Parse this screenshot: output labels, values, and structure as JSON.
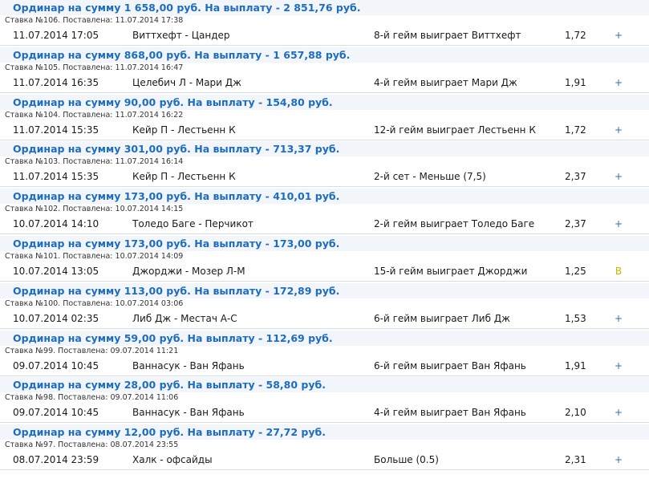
{
  "bets": [
    {
      "title": "Ординар на сумму 1 658,00 руб.  На выплату - 2 851,76 руб.",
      "meta": "Ставка №106. Поставлена: 11.07.2014 17:38",
      "datetime": "11.07.2014 17:05",
      "match": "Виттхефт - Цандер",
      "event": "8-й гейм выиграет Виттхефт",
      "odds": "1,72",
      "result": "+"
    },
    {
      "title": "Ординар на сумму 868,00 руб.  На выплату - 1 657,88 руб.",
      "meta": "Ставка №105. Поставлена: 11.07.2014 16:47",
      "datetime": "11.07.2014 16:35",
      "match": "Целебич Л - Мари Дж",
      "event": "4-й гейм выиграет Мари Дж",
      "odds": "1,91",
      "result": "+"
    },
    {
      "title": "Ординар на сумму 90,00 руб.  На выплату - 154,80 руб.",
      "meta": "Ставка №104. Поставлена: 11.07.2014 16:22",
      "datetime": "11.07.2014 15:35",
      "match": "Кейр П - Лестьенн К",
      "event": "12-й гейм выиграет Лестьенн К",
      "odds": "1,72",
      "result": "+"
    },
    {
      "title": "Ординар на сумму 301,00 руб.  На выплату - 713,37 руб.",
      "meta": "Ставка №103. Поставлена: 11.07.2014 16:14",
      "datetime": "11.07.2014 15:35",
      "match": "Кейр П - Лестьенн К",
      "event": "2-й сет - Меньше (7,5)",
      "odds": "2,37",
      "result": "+"
    },
    {
      "title": "Ординар на сумму 173,00 руб.  На выплату - 410,01 руб.",
      "meta": "Ставка №102. Поставлена: 10.07.2014 14:15",
      "datetime": "10.07.2014 14:10",
      "match": "Толедо Баге - Перчикот",
      "event": "2-й гейм выиграет Толедо Баге",
      "odds": "2,37",
      "result": "+"
    },
    {
      "title": "Ординар на сумму 173,00 руб.  На выплату - 173,00 руб.",
      "meta": "Ставка №101. Поставлена: 10.07.2014 14:09",
      "datetime": "10.07.2014 13:05",
      "match": "Джорджи - Мозер Л-М",
      "event": "15-й гейм выиграет Джорджи",
      "odds": "1,25",
      "result": "В"
    },
    {
      "title": "Ординар на сумму 113,00 руб.  На выплату - 172,89 руб.",
      "meta": "Ставка №100. Поставлена: 10.07.2014 03:06",
      "datetime": "10.07.2014 02:35",
      "match": "Либ Дж - Местач А-С",
      "event": "6-й гейм выиграет Либ Дж",
      "odds": "1,53",
      "result": "+"
    },
    {
      "title": "Ординар на сумму 59,00 руб.  На выплату - 112,69 руб.",
      "meta": "Ставка №99. Поставлена: 09.07.2014 11:21",
      "datetime": "09.07.2014 10:45",
      "match": "Ваннасук - Ван Яфань",
      "event": "6-й гейм выиграет Ван Яфань",
      "odds": "1,91",
      "result": "+"
    },
    {
      "title": "Ординар на сумму 28,00 руб.  На выплату - 58,80 руб.",
      "meta": "Ставка №98. Поставлена: 09.07.2014 11:06",
      "datetime": "09.07.2014 10:45",
      "match": "Ваннасук - Ван Яфань",
      "event": "4-й гейм выиграет Ван Яфань",
      "odds": "2,10",
      "result": "+"
    },
    {
      "title": "Ординар на сумму 12,00 руб.  На выплату - 27,72 руб.",
      "meta": "Ставка №97. Поставлена: 08.07.2014 23:55",
      "datetime": "08.07.2014 23:59",
      "match": "Халк - офсайды",
      "event": "Больше (0.5)",
      "odds": "2,31",
      "result": "+"
    }
  ],
  "colors": {
    "title": "#1d6cc4",
    "result_win": "#2f6fb5",
    "result_return": "#c8b400"
  }
}
